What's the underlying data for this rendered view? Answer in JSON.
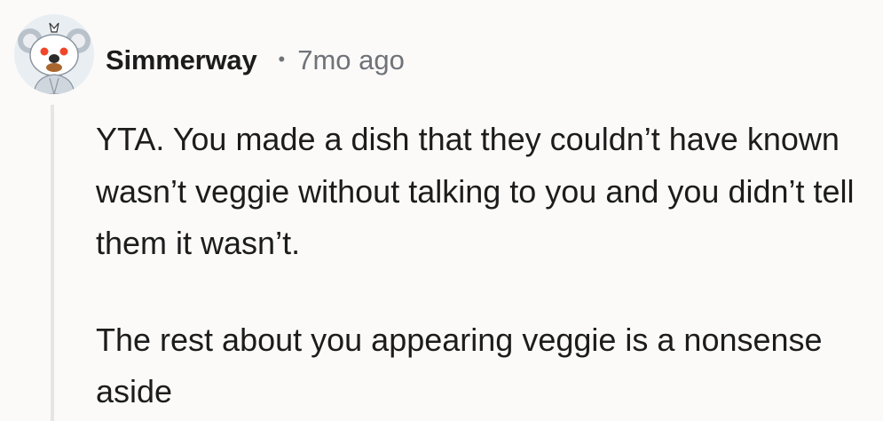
{
  "comment": {
    "author": {
      "username": "Simmerway",
      "avatar_icon": "snoo-koala-avatar-icon"
    },
    "separator": "•",
    "timestamp": "7mo ago",
    "body": [
      "YTA. You made a dish that they couldn’t have known wasn’t veggie without talking to you and you didn’t tell them it wasn’t.",
      "The rest about you appearing veggie is a nonsense aside"
    ]
  },
  "colors": {
    "background": "#fbfaf9",
    "text": "#1c1c1c",
    "meta_text": "#6f7378",
    "thread_line": "#e8e4e1"
  }
}
